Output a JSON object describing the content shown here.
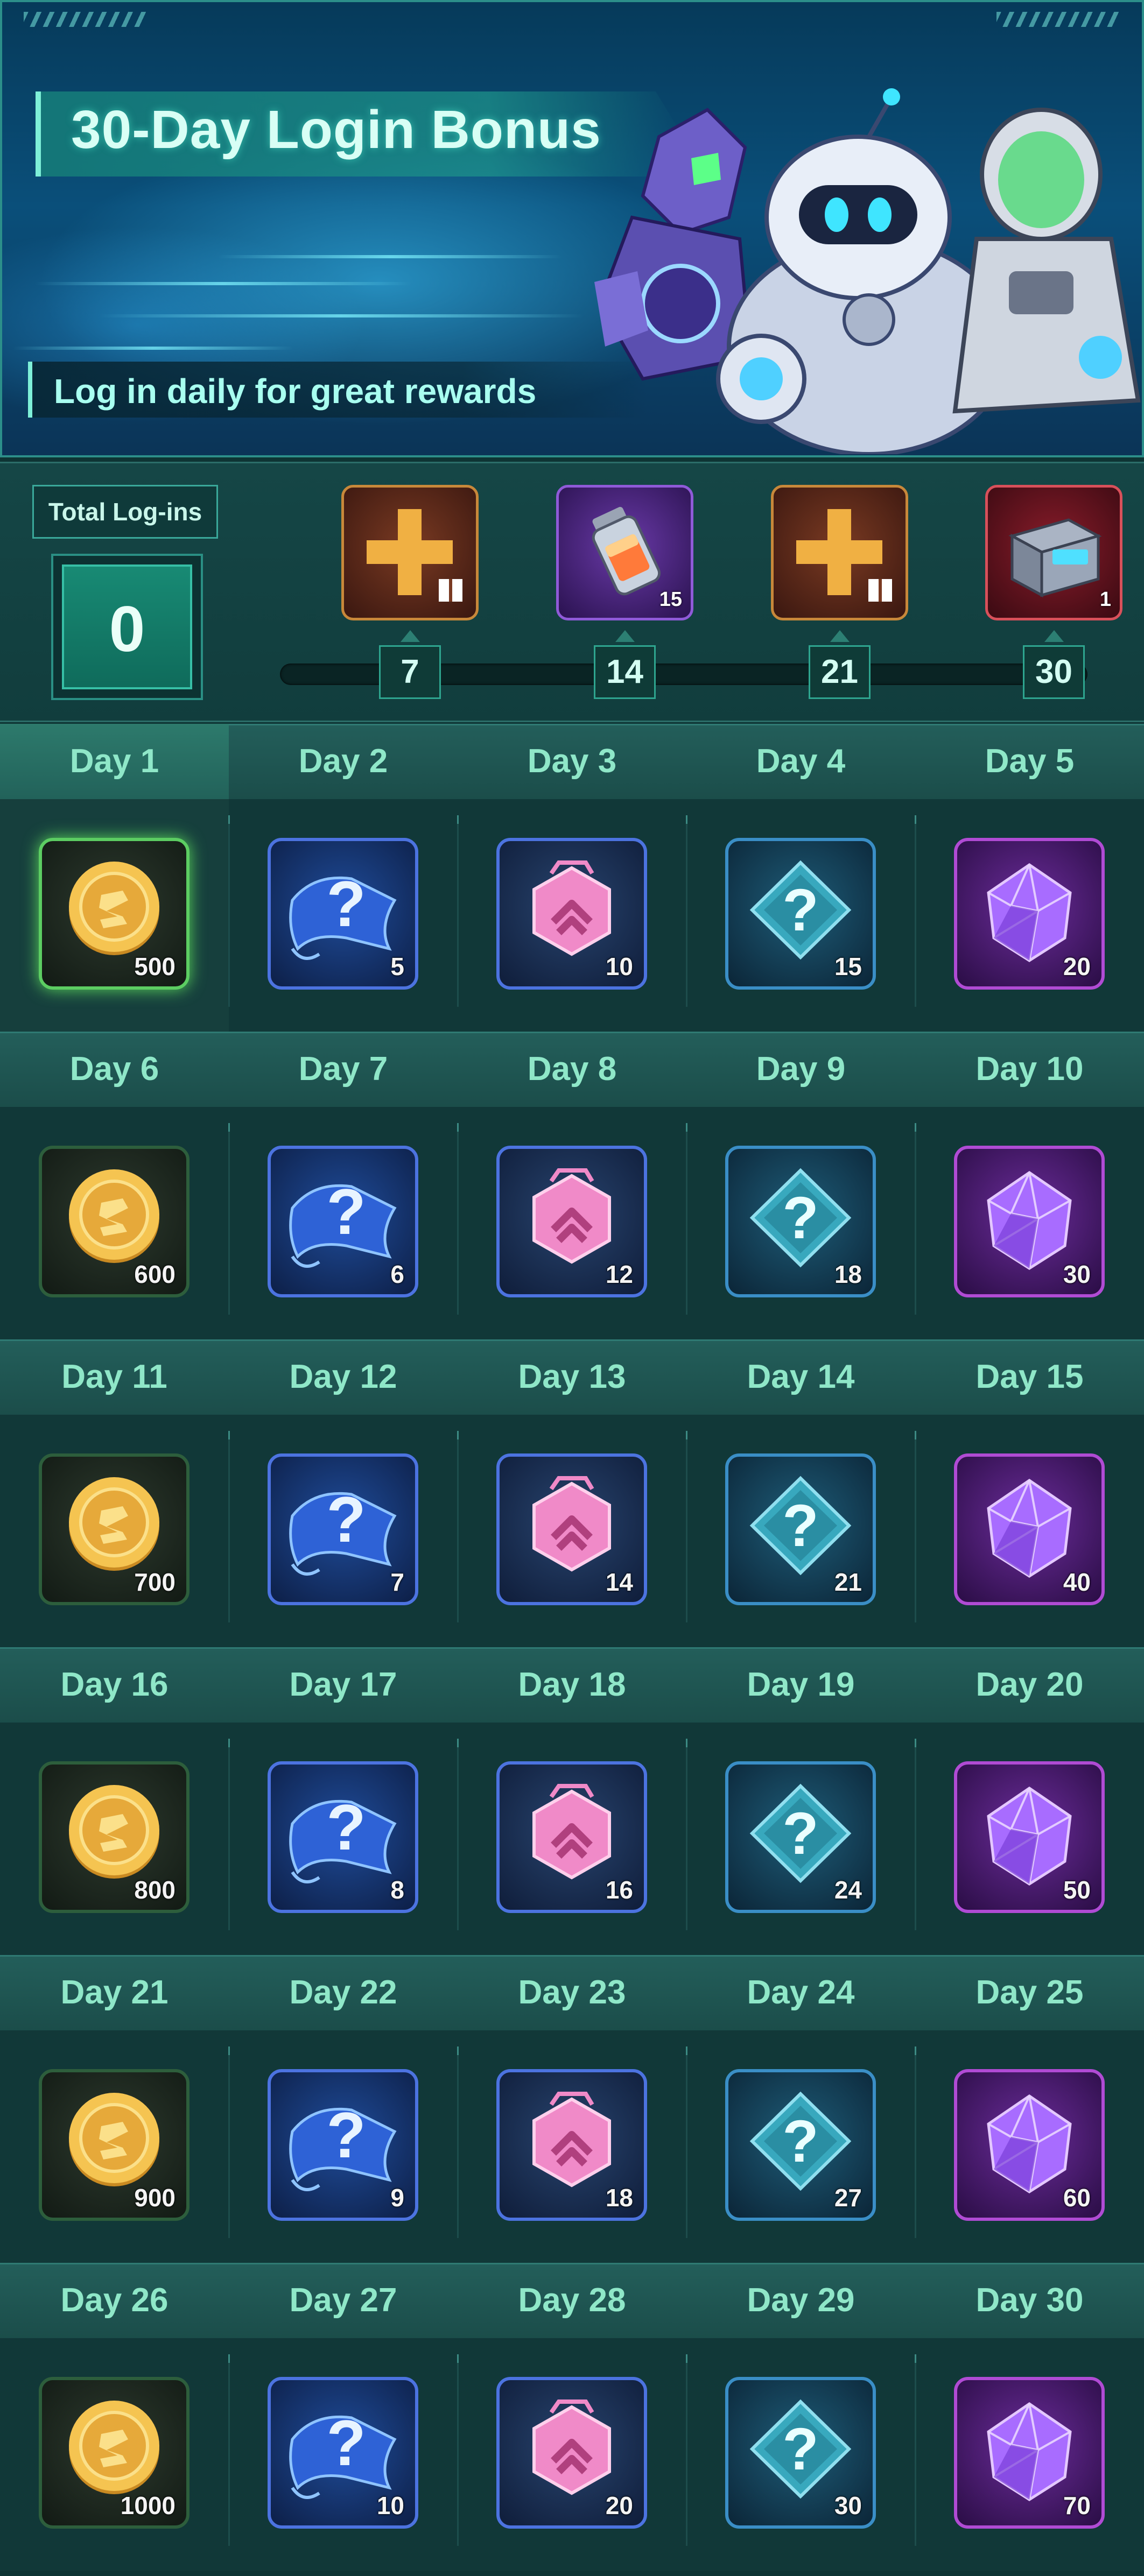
{
  "banner": {
    "title": "30-Day Login Bonus",
    "subtitle": "Log in daily for great rewards"
  },
  "progress": {
    "total_label": "Total Log-ins",
    "total_value": "0",
    "progress_fraction": 0,
    "milestones": [
      {
        "day": "7",
        "reward": "gift-chest-icon",
        "qty": ""
      },
      {
        "day": "14",
        "reward": "fuel-canister-icon",
        "qty": "15"
      },
      {
        "day": "21",
        "reward": "gift-chest-icon",
        "qty": ""
      },
      {
        "day": "30",
        "reward": "weapon-crate-icon",
        "qty": "1"
      }
    ]
  },
  "reward_types": [
    "gold-coin-icon",
    "blueprint-scroll-icon",
    "pink-chip-icon",
    "mystery-box-icon",
    "purple-gem-icon"
  ],
  "weeks": [
    {
      "days": [
        "Day 1",
        "Day 2",
        "Day 3",
        "Day 4",
        "Day 5"
      ],
      "qty": [
        "500",
        "5",
        "10",
        "15",
        "20"
      ]
    },
    {
      "days": [
        "Day 6",
        "Day 7",
        "Day 8",
        "Day 9",
        "Day 10"
      ],
      "qty": [
        "600",
        "6",
        "12",
        "18",
        "30"
      ]
    },
    {
      "days": [
        "Day 11",
        "Day 12",
        "Day 13",
        "Day 14",
        "Day 15"
      ],
      "qty": [
        "700",
        "7",
        "14",
        "21",
        "40"
      ]
    },
    {
      "days": [
        "Day 16",
        "Day 17",
        "Day 18",
        "Day 19",
        "Day 20"
      ],
      "qty": [
        "800",
        "8",
        "16",
        "24",
        "50"
      ]
    },
    {
      "days": [
        "Day 21",
        "Day 22",
        "Day 23",
        "Day 24",
        "Day 25"
      ],
      "qty": [
        "900",
        "9",
        "18",
        "27",
        "60"
      ]
    },
    {
      "days": [
        "Day 26",
        "Day 27",
        "Day 28",
        "Day 29",
        "Day 30"
      ],
      "qty": [
        "1000",
        "10",
        "20",
        "30",
        "70"
      ]
    }
  ],
  "colors": {
    "background": "#0e3434",
    "accent": "#3ee8c4",
    "day_label": "#8fe7c8",
    "gold": "#e9b449",
    "gem": "#b04bd4"
  }
}
